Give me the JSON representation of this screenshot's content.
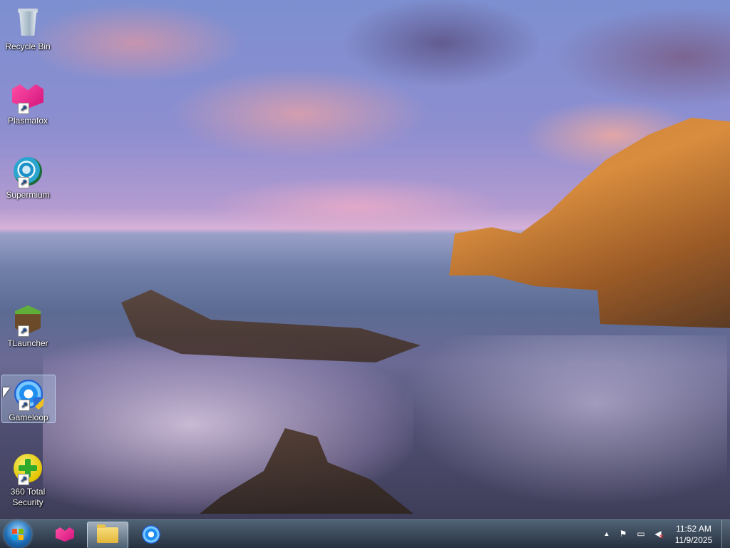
{
  "desktop": {
    "icons": [
      {
        "label": "Recycle Bin",
        "icon": "recycle-bin-icon"
      },
      {
        "label": "Plasmafox",
        "icon": "plasmafox-icon"
      },
      {
        "label": "Supermium",
        "icon": "supermium-icon"
      },
      {
        "label": "TLauncher",
        "icon": "tlauncher-icon"
      },
      {
        "label": "Gameloop",
        "icon": "gameloop-icon",
        "selected": true
      },
      {
        "label": "360 Total\nSecurity",
        "icon": "360-total-security-icon"
      }
    ]
  },
  "taskbar": {
    "start_button_icon": "windows-start-icon",
    "pinned": [
      {
        "icon": "plasmafox-icon"
      },
      {
        "icon": "file-explorer-icon",
        "active": true
      },
      {
        "icon": "gameloop-icon"
      }
    ],
    "tray": {
      "icons": [
        "show-hidden-icons-arrow",
        "action-center-flag-icon",
        "network-icon",
        "volume-muted-icon"
      ],
      "time": "11:52 AM",
      "date": "11/9/2025"
    }
  }
}
